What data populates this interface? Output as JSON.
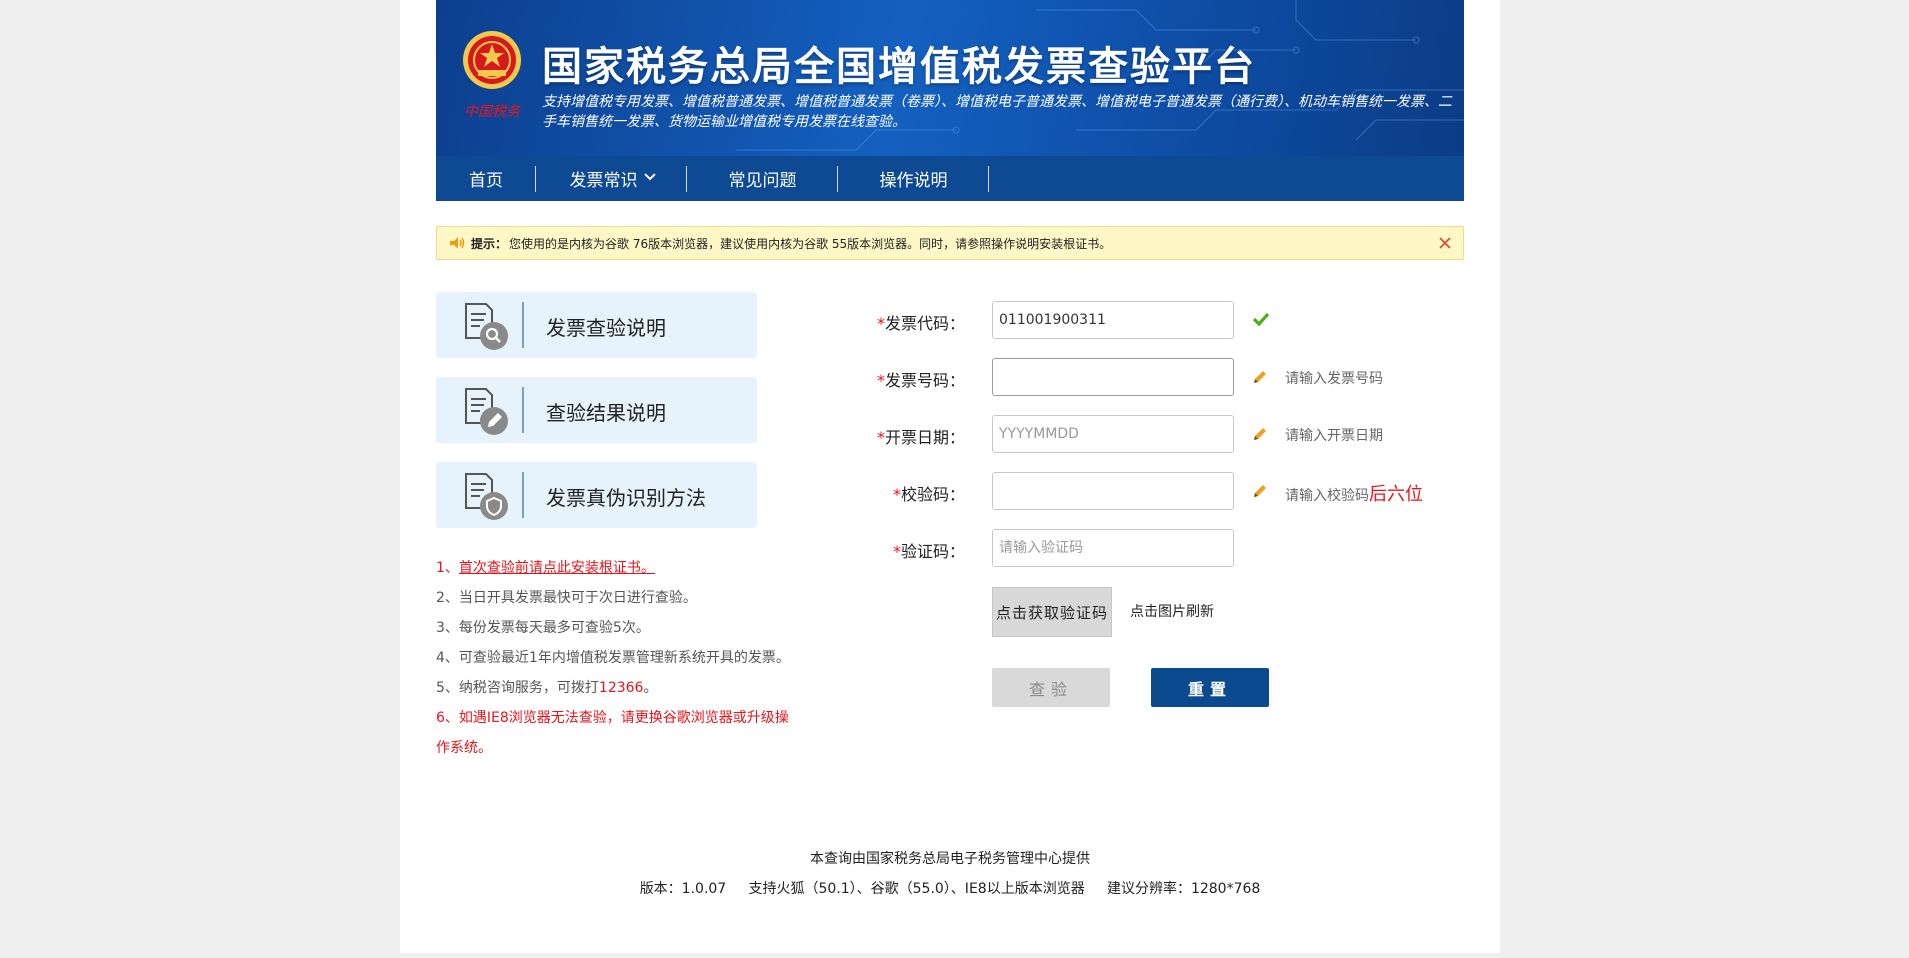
{
  "header": {
    "title": "国家税务总局全国增值税发票查验平台",
    "subtitle": "支持增值税专用发票、增值税普通发票、增值税普通发票（卷票）、增值税电子普通发票、增值税电子普通发票（通行费）、机动车销售统一发票、二手车销售统一发票、货物运输业增值税专用发票在线查验。",
    "emblem_text": "中国税务"
  },
  "nav": {
    "items": [
      {
        "label": "首页"
      },
      {
        "label": "发票常识"
      },
      {
        "label": "常见问题"
      },
      {
        "label": "操作说明"
      }
    ]
  },
  "notice": {
    "prefix": "提示：",
    "text": "您使用的是内核为谷歌 76版本浏览器，建议使用内核为谷歌 55版本浏览器。同时，请参照操作说明安装根证书。"
  },
  "side_cards": [
    {
      "label": "发票查验说明",
      "icon": "document-search-icon"
    },
    {
      "label": "查验结果说明",
      "icon": "document-edit-icon"
    },
    {
      "label": "发票真伪识别方法",
      "icon": "document-shield-icon"
    }
  ],
  "tips": {
    "t1_num": "1、",
    "t1_link": "首次查验前请点此安装根证书。",
    "t2": "2、当日开具发票最快可于次日进行查验。",
    "t3": "3、每份发票每天最多可查验5次。",
    "t4": "4、可查验最近1年内增值税发票管理新系统开具的发票。",
    "t5_pre": "5、纳税咨询服务，可拨打",
    "t5_phone": "12366",
    "t5_post": "。",
    "t6": "6、如遇IE8浏览器无法查验，请更换谷歌浏览器或升级操作系统。"
  },
  "form": {
    "required_mark": "*",
    "code": {
      "label": "发票代码：",
      "value": "011001900311"
    },
    "number": {
      "label": "发票号码：",
      "value": "",
      "hint": "请输入发票号码"
    },
    "date": {
      "label": "开票日期：",
      "placeholder": "YYYYMMDD",
      "hint": "请输入开票日期"
    },
    "check_code": {
      "label": "校验码：",
      "hint": "请输入校验码",
      "hint_red": "后六位"
    },
    "captcha": {
      "label": "验证码：",
      "placeholder": "请输入验证码",
      "image_text": "点击获取验证码",
      "refresh_note": "点击图片刷新"
    },
    "verify_label": "查验",
    "reset_label": "重置"
  },
  "footer": {
    "provider": "本查询由国家税务总局电子税务管理中心提供",
    "info": "版本：1.0.07     支持火狐（50.1）、谷歌（55.0）、IE8以上版本浏览器     建议分辨率：1280*768"
  },
  "colors": {
    "header_blue": "#1460c0",
    "nav_blue": "#0d4a93",
    "notice_bg": "#fff7c6",
    "accent_red": "#e8141c",
    "reset_blue": "#0c4a8f",
    "card_bg": "#e6f2fc"
  }
}
